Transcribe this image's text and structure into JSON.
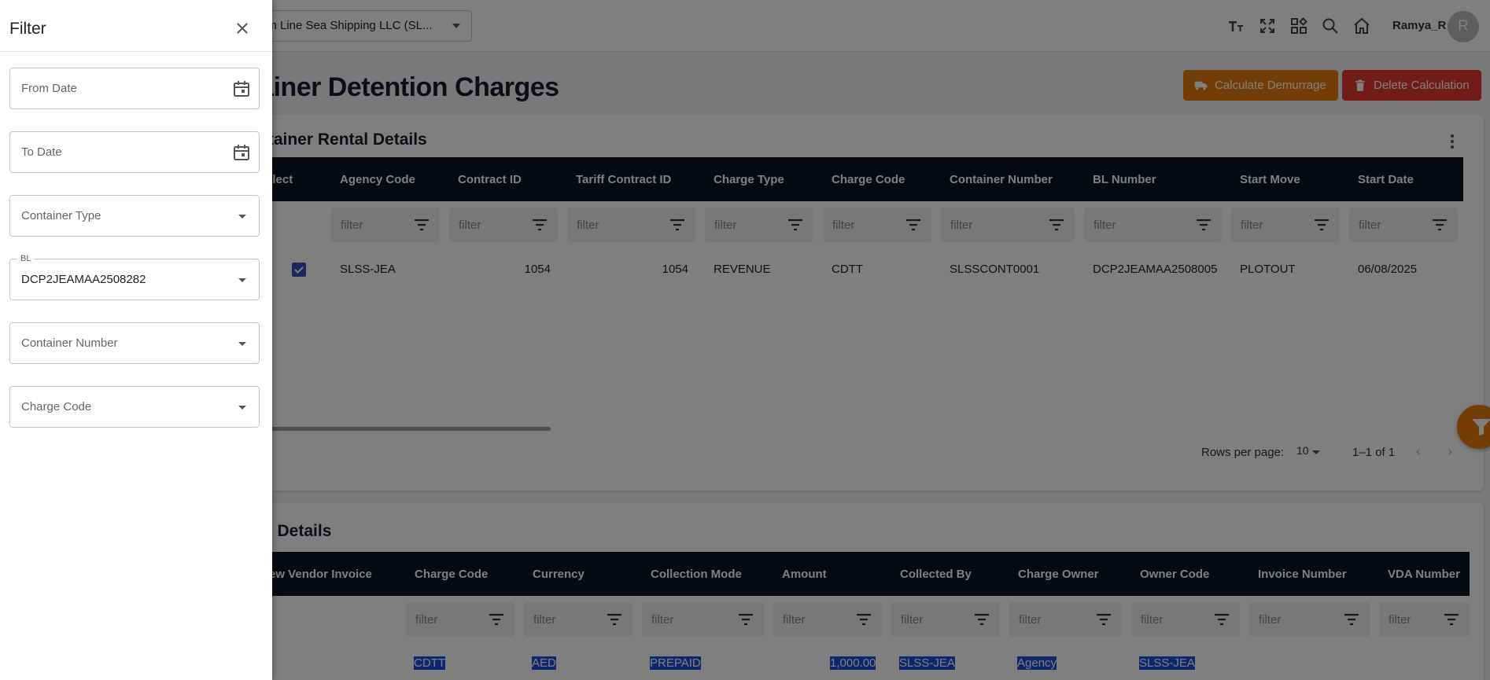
{
  "header": {
    "company": "am Line Sea Shipping LLC  (SL...",
    "username": "Ramya_R",
    "avatar_initial": "R",
    "icons": [
      "text-size-icon",
      "fullscreen-icon",
      "apps-icon",
      "search-icon",
      "home-icon"
    ]
  },
  "page": {
    "title": "ntainer Detention Charges",
    "buttons": {
      "calculate": "Calculate Demurrage",
      "delete": "Delete Calculation"
    }
  },
  "rental": {
    "title": "ntainer Rental Details",
    "columns": [
      "elect",
      "Agency Code",
      "Contract ID",
      "Tariff Contract ID",
      "Charge Type",
      "Charge Code",
      "Container Number",
      "BL Number",
      "Start Move",
      "Start Date"
    ],
    "filter_placeholder": "filter",
    "row": {
      "agency_code": "SLSS-JEA",
      "contract_id": "1054",
      "tariff_contract_id": "1054",
      "charge_type": "REVENUE",
      "charge_code": "CDTT",
      "container_number": "SLSSCONT0001",
      "bl_number": "DCP2JEAMAA2508005",
      "start_move": "PLOTOUT",
      "start_date": "06/08/2025",
      "selected": true
    },
    "pager": {
      "rows_label": "Rows per page:",
      "rows_value": "10",
      "range": "1–1 of 1"
    }
  },
  "rate": {
    "title": "te Details",
    "columns": [
      "ew Vendor Invoice",
      "Charge Code",
      "Currency",
      "Collection Mode",
      "Amount",
      "Collected By",
      "Charge Owner",
      "Owner Code",
      "Invoice Number",
      "VDA Number"
    ],
    "filter_placeholder": "filter",
    "row": {
      "charge_code": "CDTT",
      "currency": "AED",
      "collection_mode": "PREPAID",
      "amount": "1,000.00",
      "collected_by": "SLSS-JEA",
      "charge_owner": "Agency",
      "owner_code": "SLSS-JEA"
    }
  },
  "filter_drawer": {
    "title": "Filter",
    "from_date": "From Date",
    "to_date": "To Date",
    "container_type": "Container Type",
    "bl_label": "BL",
    "bl_value": "DCP2JEAMAA2508282",
    "container_number": "Container Number",
    "charge_code": "Charge Code"
  },
  "colors": {
    "accent_orange": "#e87b0c",
    "danger_red": "#e53935",
    "table_header": "#0f1623",
    "selection_blue": "#1e4fd8"
  }
}
